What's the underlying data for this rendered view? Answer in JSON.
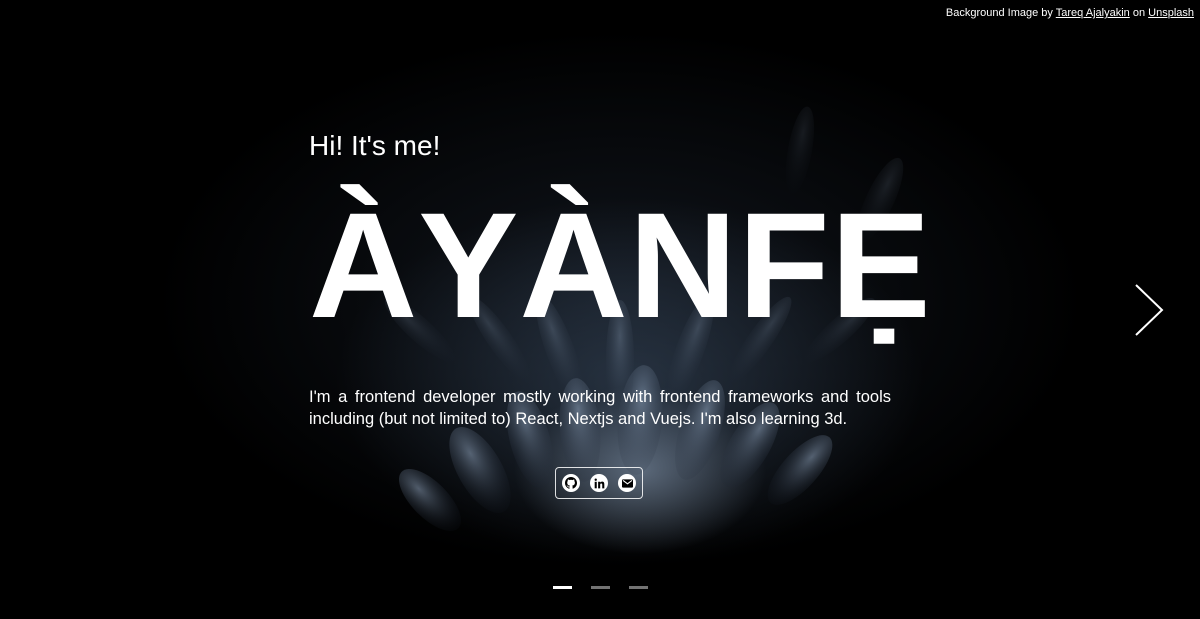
{
  "credit": {
    "prefix": "Background Image by",
    "author": "Tareq Ajalyakin",
    "middle": "on",
    "site": "Unsplash"
  },
  "hero": {
    "greeting": "Hi! It's me!",
    "name": "ÀYÀNFẸ",
    "bio": "I'm a frontend developer mostly working with frontend frameworks and tools including (but not limited to) React, Nextjs and Vuejs. I'm also learning 3d."
  },
  "socials": [
    {
      "icon": "github-icon"
    },
    {
      "icon": "linkedin-icon"
    },
    {
      "icon": "mail-icon"
    }
  ],
  "slider": {
    "slides": 3,
    "active": 1
  },
  "colors": {
    "background": "#000000",
    "text": "#ffffff"
  }
}
